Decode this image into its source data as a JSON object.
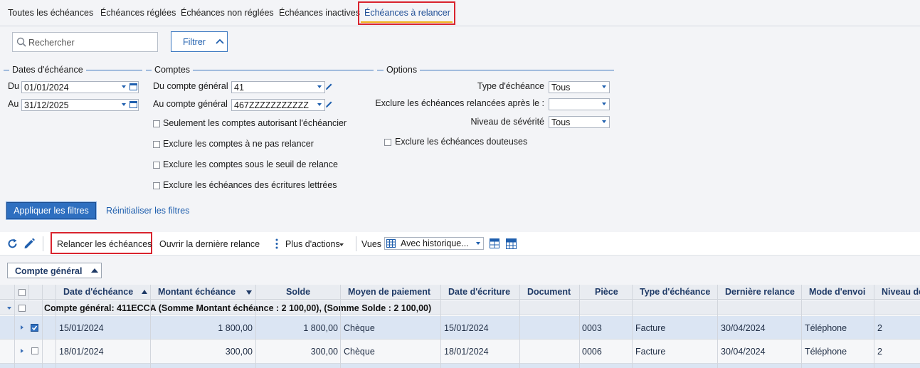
{
  "tabs": [
    {
      "label": "Toutes les échéances"
    },
    {
      "label": "Échéances réglées"
    },
    {
      "label": "Échéances non réglées"
    },
    {
      "label": "Échéances inactives"
    },
    {
      "label": "Échéances à relancer",
      "active": true
    }
  ],
  "search": {
    "placeholder": "Rechercher",
    "value": ""
  },
  "filter_button": {
    "label": "Filtrer"
  },
  "dates": {
    "title": "Dates d'échéance",
    "from_label": "Du",
    "from_value": "01/01/2024",
    "to_label": "Au",
    "to_value": "31/12/2025"
  },
  "comptes": {
    "title": "Comptes",
    "from_label": "Du compte général",
    "from_value": "41",
    "to_label": "Au compte général",
    "to_value": "467ZZZZZZZZZZZ",
    "checks": [
      {
        "label": "Seulement les comptes autorisant l'échéancier",
        "checked": false
      },
      {
        "label": "Exclure les comptes à ne pas relancer",
        "checked": false
      },
      {
        "label": "Exclure les comptes sous le seuil de relance",
        "checked": false
      },
      {
        "label": "Exclure les échéances des écritures lettrées",
        "checked": false
      }
    ]
  },
  "options": {
    "title": "Options",
    "type_label": "Type d'échéance",
    "type_value": "Tous",
    "exclure_label": "Exclure les échéances relancées après le :",
    "exclure_value": "",
    "niveau_label": "Niveau de sévérité",
    "niveau_value": "Tous",
    "douteuses_label": "Exclure les échéances douteuses",
    "douteuses_checked": false
  },
  "apply_button": "Appliquer les filtres",
  "reset_link": "Réinitialiser les filtres",
  "toolbar": {
    "relancer": "Relancer les échéances",
    "ouvrir": "Ouvrir la dernière relance",
    "plus": "Plus d'actions",
    "vues_label": "Vues",
    "vues_value": "Avec historique..."
  },
  "group_button": "Compte général",
  "grid": {
    "columns": [
      "Date d'échéance",
      "Montant échéance",
      "Solde",
      "Moyen de paiement",
      "Date d'écriture",
      "Document",
      "Pièce",
      "Type d'échéance",
      "Dernière relance",
      "Mode d'envoi",
      "Niveau de"
    ],
    "group_label": "Compte général: 411ECCA (Somme Montant échéance : 2 100,00), (Somme Solde : 2 100,00)",
    "rows": [
      {
        "selected": true,
        "date": "15/01/2024",
        "montant": "1 800,00",
        "solde": "1 800,00",
        "moyen": "Chèque",
        "date_ecriture": "15/01/2024",
        "document": "",
        "piece": "0003",
        "type": "Facture",
        "derniere": "30/04/2024",
        "mode": "Téléphone",
        "niveau": "2"
      },
      {
        "selected": false,
        "date": "18/01/2024",
        "montant": "300,00",
        "solde": "300,00",
        "moyen": "Chèque",
        "date_ecriture": "18/01/2024",
        "document": "",
        "piece": "0006",
        "type": "Facture",
        "derniere": "30/04/2024",
        "mode": "Téléphone",
        "niveau": "2"
      }
    ]
  },
  "colors": {
    "accent": "#1f5fae",
    "highlight_border": "#d9232e",
    "tab_underline": "#f0b31c",
    "selected_row": "#dbe5f3"
  }
}
